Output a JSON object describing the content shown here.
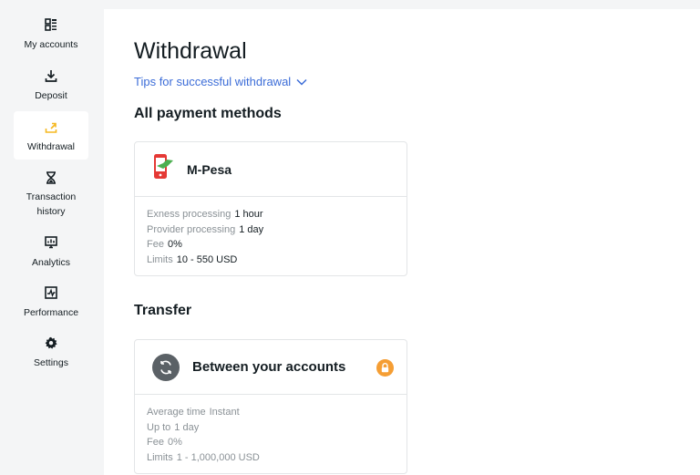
{
  "sidebar": {
    "items": [
      {
        "label": "My accounts",
        "icon": "accounts-grid-icon"
      },
      {
        "label": "Deposit",
        "icon": "download-icon"
      },
      {
        "label": "Withdrawal",
        "icon": "upload-icon",
        "active": true
      },
      {
        "label": "Transaction history",
        "icon": "hourglass-icon"
      },
      {
        "label": "Analytics",
        "icon": "analytics-icon"
      },
      {
        "label": "Performance",
        "icon": "performance-icon"
      },
      {
        "label": "Settings",
        "icon": "gear-icon"
      }
    ]
  },
  "main": {
    "title": "Withdrawal",
    "tips_label": "Tips for successful withdrawal",
    "payment_section_title": "All payment methods",
    "transfer_section_title": "Transfer"
  },
  "mpesa": {
    "name": "M-Pesa",
    "rows": [
      {
        "k": "Exness processing",
        "v": "1 hour"
      },
      {
        "k": "Provider processing",
        "v": "1 day"
      },
      {
        "k": "Fee",
        "v": "0%"
      },
      {
        "k": "Limits",
        "v": "10 - 550 USD"
      }
    ]
  },
  "transfer": {
    "name": "Between your accounts",
    "rows": [
      {
        "k": "Average time",
        "v": "Instant"
      },
      {
        "k": "Up to",
        "v": "1 day"
      },
      {
        "k": "Fee",
        "v": "0%"
      },
      {
        "k": "Limits",
        "v": "1 - 1,000,000 USD"
      }
    ]
  },
  "colors": {
    "accent_blue": "#3c6dd8",
    "active_icon_yellow": "#f5b820",
    "lock_orange": "#f59e34",
    "mpesa_red": "#e53935",
    "mpesa_green": "#4caf50"
  }
}
